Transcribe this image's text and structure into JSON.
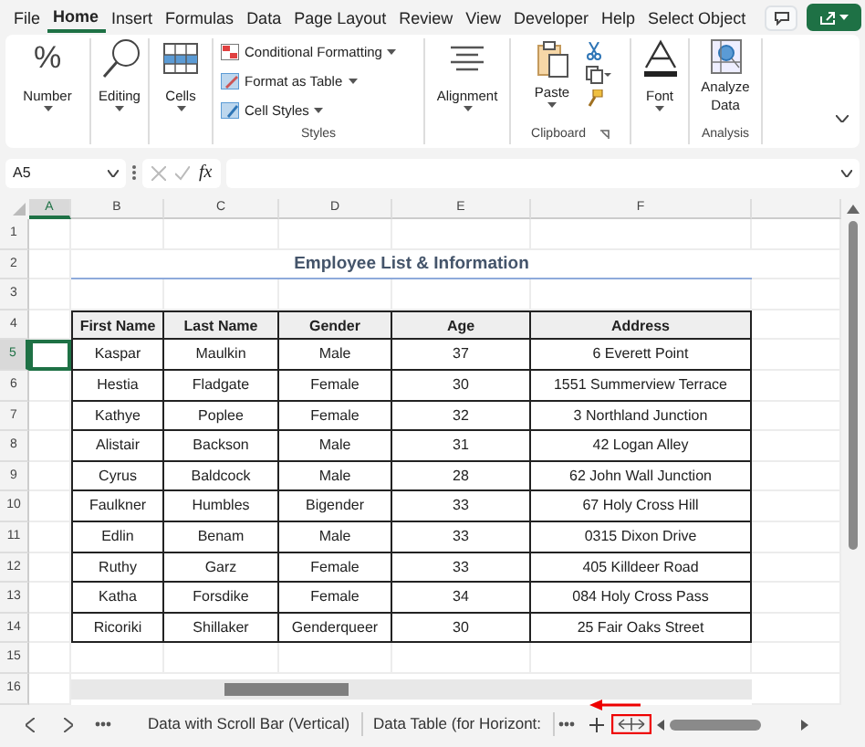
{
  "menu_tabs": [
    {
      "label": "File",
      "selected": false
    },
    {
      "label": "Home",
      "selected": true
    },
    {
      "label": "Insert",
      "selected": false
    },
    {
      "label": "Formulas",
      "selected": false
    },
    {
      "label": "Data",
      "selected": false
    },
    {
      "label": "Page Layout",
      "selected": false
    },
    {
      "label": "Review",
      "selected": false
    },
    {
      "label": "View",
      "selected": false
    },
    {
      "label": "Developer",
      "selected": false
    },
    {
      "label": "Help",
      "selected": false
    },
    {
      "label": "Select Object",
      "selected": false
    }
  ],
  "ribbon": [
    {
      "kind": "number",
      "glyph": "%",
      "label": "Number"
    },
    {
      "kind": "editing",
      "label": "Editing"
    },
    {
      "kind": "cells",
      "label": "Cells"
    },
    {
      "kind": "styles",
      "items": [
        "Conditional Formatting",
        "Format as Table",
        "Cell Styles"
      ],
      "group_label": "Styles"
    },
    {
      "kind": "alignment",
      "label": "Alignment"
    },
    {
      "kind": "clipboard",
      "label": "Paste",
      "group_label": "Clipboard"
    },
    {
      "kind": "font",
      "label": "Font"
    },
    {
      "kind": "analysis",
      "label": "Analyze Data",
      "group_label": "Analysis"
    }
  ],
  "name_box": "A5",
  "formula_icon": "fx",
  "column_headers": [
    {
      "label": "A",
      "selected": true
    },
    {
      "label": "B",
      "selected": false
    },
    {
      "label": "C",
      "selected": false
    },
    {
      "label": "D",
      "selected": false
    },
    {
      "label": "E",
      "selected": false
    },
    {
      "label": "F",
      "selected": false
    }
  ],
  "row_headers": [
    {
      "label": "1",
      "selected": false
    },
    {
      "label": "2",
      "selected": false
    },
    {
      "label": "3",
      "selected": false
    },
    {
      "label": "4",
      "selected": false
    },
    {
      "label": "5",
      "selected": true
    },
    {
      "label": "6",
      "selected": false
    },
    {
      "label": "7",
      "selected": false
    },
    {
      "label": "8",
      "selected": false
    },
    {
      "label": "9",
      "selected": false
    },
    {
      "label": "10",
      "selected": false
    },
    {
      "label": "11",
      "selected": false
    },
    {
      "label": "12",
      "selected": false
    },
    {
      "label": "13",
      "selected": false
    },
    {
      "label": "14",
      "selected": false
    },
    {
      "label": "15",
      "selected": false
    },
    {
      "label": "16",
      "selected": false
    }
  ],
  "title": "Employee List & Information",
  "table": {
    "columns": [
      "First Name",
      "Last Name",
      "Gender",
      "Age",
      "Address"
    ],
    "rows": [
      [
        "Kaspar",
        "Maulkin",
        "Male",
        "37",
        "6 Everett Point"
      ],
      [
        "Hestia",
        "Fladgate",
        "Female",
        "30",
        "1551 Summerview Terrace"
      ],
      [
        "Kathye",
        "Poplee",
        "Female",
        "32",
        "3 Northland Junction"
      ],
      [
        "Alistair",
        "Backson",
        "Male",
        "31",
        "42 Logan Alley"
      ],
      [
        "Cyrus",
        "Baldcock",
        "Male",
        "28",
        "62 John Wall Junction"
      ],
      [
        "Faulkner",
        "Humbles",
        "Bigender",
        "33",
        "67 Holy Cross Hill"
      ],
      [
        "Edlin",
        "Benam",
        "Male",
        "33",
        "0315 Dixon Drive"
      ],
      [
        "Ruthy",
        "Garz",
        "Female",
        "33",
        "405 Killdeer Road"
      ],
      [
        "Katha",
        "Forsdike",
        "Female",
        "34",
        "084 Holy Cross Pass"
      ],
      [
        "Ricoriki",
        "Shillaker",
        "Genderqueer",
        "30",
        "25 Fair Oaks Street"
      ]
    ]
  },
  "sheet_tabs": [
    "Data with Scroll Bar (Vertical)",
    "Data Table (for Horizont:"
  ]
}
